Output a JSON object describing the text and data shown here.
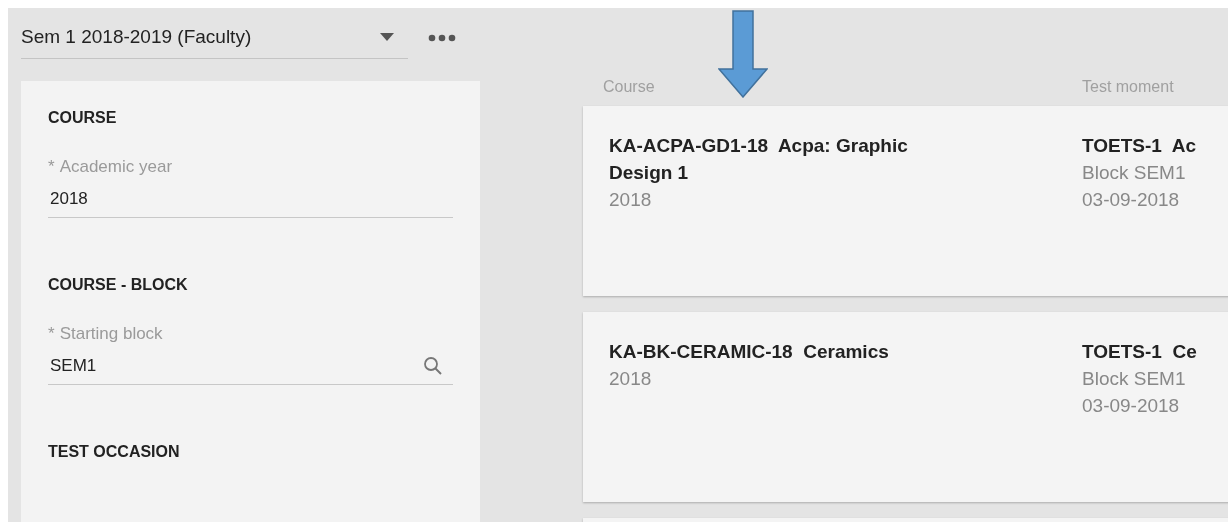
{
  "period_selector": {
    "value": "Sem 1 2018-2019 (Faculty)"
  },
  "filter_panel": {
    "sections": [
      {
        "title": "COURSE",
        "field": {
          "kind": "text",
          "required_mark": "*",
          "label": "Academic year",
          "value": "2018"
        }
      },
      {
        "title": "COURSE - BLOCK",
        "field": {
          "kind": "search",
          "required_mark": "*",
          "label": "Starting block",
          "value": "SEM1"
        }
      },
      {
        "title": "TEST OCCASION"
      }
    ]
  },
  "table": {
    "columns": [
      "Course",
      "Test moment"
    ],
    "rows": [
      {
        "course": "KA-ACPA-GD1-18  Acpa: Graphic Design 1",
        "year": "2018",
        "test": "TOETS-1  Ac",
        "block": "Block SEM1",
        "date": "03-09-2018"
      },
      {
        "course": "KA-BK-CERAMIC-18  Ceramics",
        "year": "2018",
        "test": "TOETS-1  Ce",
        "block": "Block SEM1",
        "date": "03-09-2018"
      },
      {}
    ]
  }
}
